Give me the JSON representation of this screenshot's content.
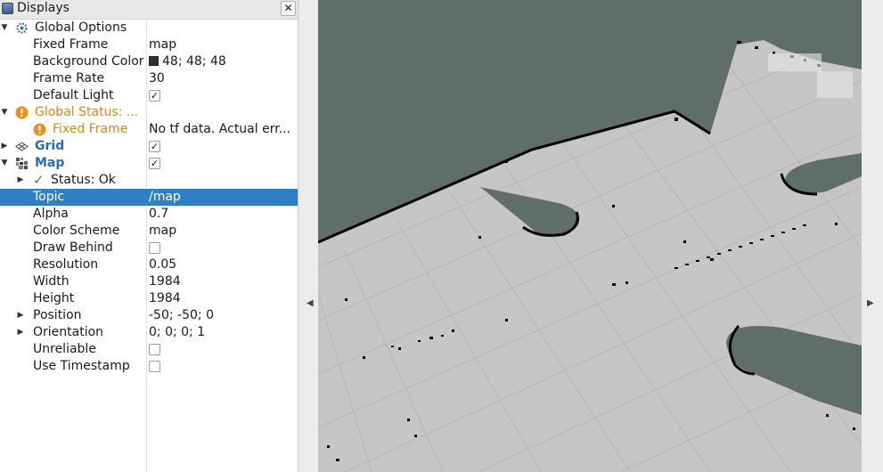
{
  "panel": {
    "title": "Displays",
    "close_label": "✕"
  },
  "tree": {
    "global_options": "Global Options",
    "fixed_frame": {
      "label": "Fixed Frame",
      "value": "map"
    },
    "background_color": {
      "label": "Background Color",
      "value": "48; 48; 48",
      "color": "#303030"
    },
    "frame_rate": {
      "label": "Frame Rate",
      "value": "30"
    },
    "default_light": {
      "label": "Default Light",
      "checked": true
    },
    "global_status": "Global Status: ...",
    "status_fixed_frame": {
      "label": "Fixed Frame",
      "value": "No tf data.  Actual err..."
    },
    "grid": {
      "label": "Grid",
      "checked": true
    },
    "map": {
      "label": "Map",
      "checked": true
    },
    "map_status": "Status: Ok",
    "topic": {
      "label": "Topic",
      "value": "/map"
    },
    "alpha": {
      "label": "Alpha",
      "value": "0.7"
    },
    "color_scheme": {
      "label": "Color Scheme",
      "value": "map"
    },
    "draw_behind": {
      "label": "Draw Behind",
      "checked": false
    },
    "resolution": {
      "label": "Resolution",
      "value": "0.05"
    },
    "width": {
      "label": "Width",
      "value": "1984"
    },
    "height": {
      "label": "Height",
      "value": "1984"
    },
    "position": {
      "label": "Position",
      "value": "-50; -50; 0"
    },
    "orientation": {
      "label": "Orientation",
      "value": "0; 0; 0; 1"
    },
    "unreliable": {
      "label": "Unreliable",
      "checked": false
    },
    "use_timestamp": {
      "label": "Use Timestamp",
      "checked": false
    }
  },
  "colors": {
    "selection": "#2f80c2",
    "warning": "#c98a1a",
    "map_free": "#c6c6c6",
    "map_unknown": "#5f6e6b",
    "map_occupied": "#000000"
  }
}
